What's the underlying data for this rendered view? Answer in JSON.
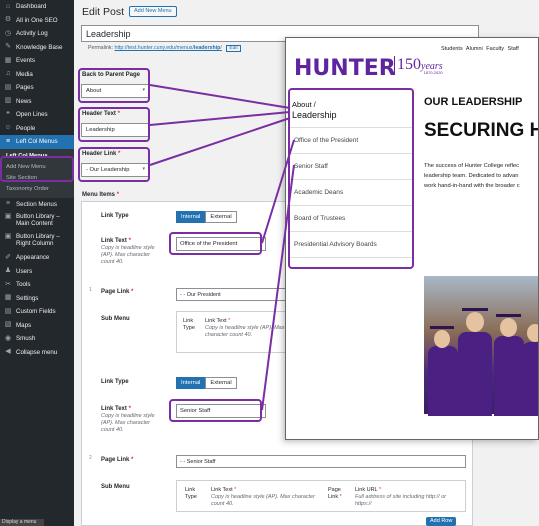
{
  "sidebar": {
    "items": [
      {
        "label": "Dashboard",
        "icon": "dashboard-icon",
        "glyph": "⌂"
      },
      {
        "label": "All in One SEO",
        "icon": "seo-icon",
        "glyph": "⚙"
      },
      {
        "label": "Activity Log",
        "icon": "clock-icon",
        "glyph": "◷"
      },
      {
        "label": "Knowledge Base",
        "icon": "graduation-icon",
        "glyph": "✎"
      },
      {
        "label": "Events",
        "icon": "calendar-icon",
        "glyph": "▦"
      },
      {
        "label": "Media",
        "icon": "media-icon",
        "glyph": "♫"
      },
      {
        "label": "Pages",
        "icon": "pages-icon",
        "glyph": "▤"
      },
      {
        "label": "News",
        "icon": "news-icon",
        "glyph": "▥"
      },
      {
        "label": "Open Lines",
        "icon": "quote-icon",
        "glyph": "❝"
      },
      {
        "label": "People",
        "icon": "people-icon",
        "glyph": "☺"
      }
    ],
    "active": {
      "label": "Left Col Menus",
      "icon": "menu-icon",
      "glyph": "≡"
    },
    "submenu": [
      "Left Col Menus",
      "Add New Menu",
      "Site Section",
      "Taxonomy Order"
    ],
    "items2": [
      {
        "label": "Section Menus",
        "icon": "menu-icon",
        "glyph": "≡"
      },
      {
        "label": "Button Library – Main Content",
        "icon": "button-icon",
        "glyph": "▣"
      },
      {
        "label": "Button Library – Right Column",
        "icon": "button-icon",
        "glyph": "▣"
      },
      {
        "label": "Appearance",
        "icon": "brush-icon",
        "glyph": "✐"
      },
      {
        "label": "Users",
        "icon": "user-icon",
        "glyph": "♟"
      },
      {
        "label": "Tools",
        "icon": "wrench-icon",
        "glyph": "✂"
      },
      {
        "label": "Settings",
        "icon": "settings-icon",
        "glyph": "▦"
      },
      {
        "label": "Custom Fields",
        "icon": "fields-icon",
        "glyph": "▤"
      },
      {
        "label": "Maps",
        "icon": "map-icon",
        "glyph": "▧"
      },
      {
        "label": "Smush",
        "icon": "smush-icon",
        "glyph": "◉"
      },
      {
        "label": "Collapse menu",
        "icon": "collapse-icon",
        "glyph": "◀"
      }
    ],
    "display_menu": "Display a menu"
  },
  "editor": {
    "page_title": "Edit Post",
    "add_new": "Add New Menu",
    "title_value": "Leadership",
    "permalink_label": "Permalink:",
    "permalink_url_prefix": "http://test.hunter.cuny.edu/menus/",
    "permalink_slug": "leadership",
    "permalink_tail": "/",
    "permalink_edit": "Edit",
    "back_label": "Back to Parent Page",
    "back_value": "About",
    "header_text_label": "Header Text",
    "header_text_value": "Leadership",
    "header_link_label": "Header Link",
    "header_link_value": "- Our Leadership",
    "required": "*",
    "menu_items_label": "Menu Items",
    "row1_num": "1",
    "row2_num": "2",
    "link_type_label": "Link Type",
    "internal": "Internal",
    "external": "External",
    "link_text_label": "Link Text",
    "link_text_desc": "Copy is headline style (AP). Max character count 40.",
    "row1_link_text": "Office of the President",
    "row2_link_text": "Senior Staff",
    "page_link_label": "Page Link",
    "row1_page_link": "- - Our President",
    "row2_page_link": "- - Senior Staff",
    "sub_menu_label": "Sub Menu",
    "sub_link_type": "Link Type",
    "sub_link_text": "Link Text",
    "sub_link_text_desc": "Copy is headline style (AP). Max character count 40.",
    "sub_page_link": "Page Link",
    "sub_link_url": "Link URL",
    "sub_link_url_desc": "Full address of site including http:// or https://",
    "add_row": "Add Row"
  },
  "preview": {
    "logo": "HUNTER",
    "logo_150": "150",
    "logo_years": "years",
    "logo_dates": "1870-2020",
    "nav": "Students  Alumni  Faculty  Staff",
    "crumb": "About /",
    "current": "Leadership",
    "links": [
      "Office of the President",
      "Senior Staff",
      "Academic Deans",
      "Board of Trustees",
      "Presidential Advisory Boards"
    ],
    "kicker": "OUR LEADERSHIP",
    "heading": "SECURING HU",
    "body": [
      "The success of Hunter College reflec",
      "leadership team. Dedicated to advan",
      "work hand-in-hand with the broader c"
    ]
  },
  "colors": {
    "purple": "#7b2da3",
    "wp_blue": "#2271b1",
    "hunter_purple": "#5f259f"
  }
}
